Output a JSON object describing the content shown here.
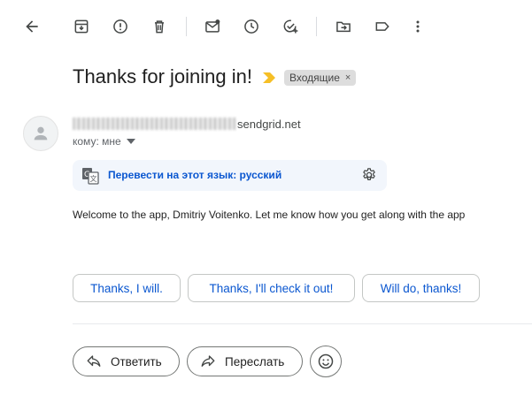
{
  "toolbar": {
    "icons": [
      "back-arrow-icon",
      "archive-icon",
      "report-spam-icon",
      "delete-icon",
      "mark-unread-icon",
      "snooze-icon",
      "add-to-tasks-icon",
      "move-to-icon",
      "labels-icon",
      "more-vert-icon"
    ]
  },
  "email": {
    "subject": "Thanks for joining in!",
    "label_chip": "Входящие",
    "label_chip_close": "×",
    "sender_domain": "sendgrid.net",
    "to_text": "кому: мне",
    "body": "Welcome to the app, Dmitriy Voitenko. Let me know how you get along with the app"
  },
  "translate": {
    "text": "Перевести на этот язык: русский"
  },
  "smart_replies": [
    "Thanks, I will.",
    "Thanks, I'll check it out!",
    "Will do, thanks!"
  ],
  "actions": {
    "reply_label": "Ответить",
    "forward_label": "Переслать"
  },
  "colors": {
    "accent_blue": "#0b57d0",
    "importance_marker": "#f6bf26",
    "icon_gray": "#444746"
  }
}
